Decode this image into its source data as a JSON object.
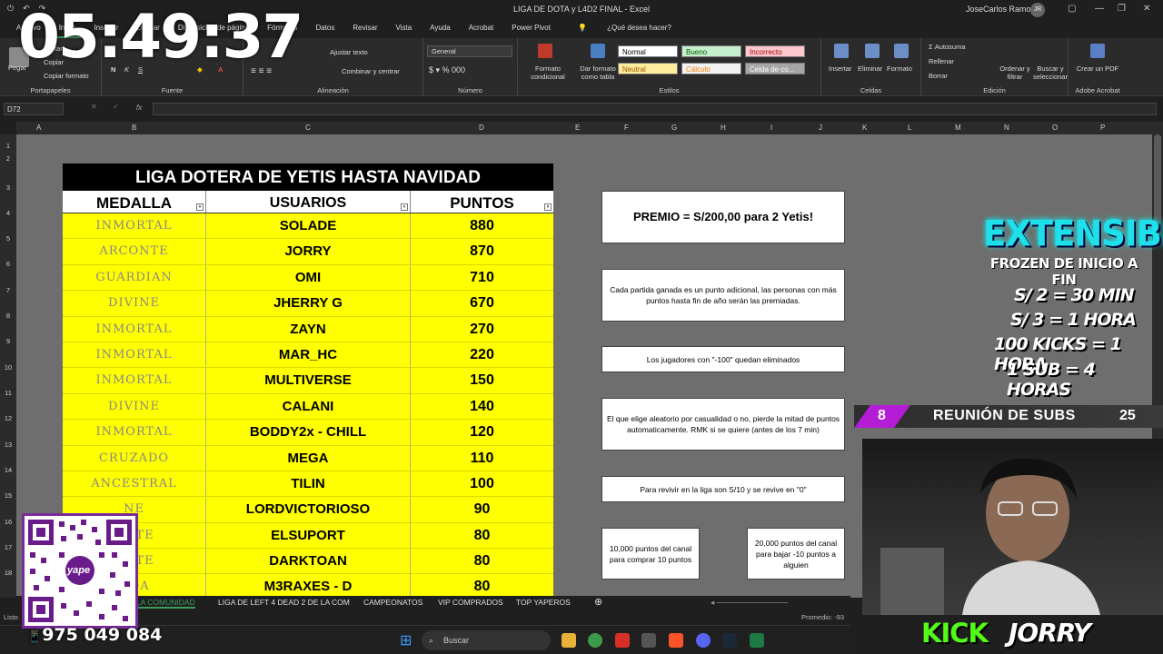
{
  "window": {
    "title": "LIGA DE DOTA y L4D2 FINAL  -  Excel",
    "user": "JoseCarlos Ramos",
    "user_initials": "JR"
  },
  "ribbon_tabs": [
    "Archivo",
    "Inicio",
    "Insertar",
    "Dibujar",
    "Disposición de página",
    "Fórmulas",
    "Datos",
    "Revisar",
    "Vista",
    "Ayuda",
    "Acrobat",
    "Power Pivot"
  ],
  "tell_me": "¿Qué desea hacer?",
  "ribbon": {
    "clipboard": {
      "paste": "Pegar",
      "cut": "Cortar",
      "copy": "Copiar",
      "format_painter": "Copiar formato",
      "label": "Portapapeles"
    },
    "font": {
      "label": "Fuente"
    },
    "alignment": {
      "wrap": "Ajustar texto",
      "merge": "Combinar y centrar",
      "label": "Alineación"
    },
    "number": {
      "format": "General",
      "label": "Número"
    },
    "styles": {
      "conditional": "Formato condicional",
      "as_table": "Dar formato como tabla",
      "normal": "Normal",
      "good": "Bueno",
      "bad": "Incorrecto",
      "neutral": "Neutral",
      "calc": "Cálculo",
      "cell": "Celda de co...",
      "label": "Estilos"
    },
    "cells": {
      "insert": "Insertar",
      "delete": "Eliminar",
      "format": "Formato",
      "label": "Celdas"
    },
    "editing": {
      "autosum": "Autosuma",
      "fill": "Rellenar",
      "clear": "Borrar",
      "sort": "Ordenar y filtrar",
      "find": "Buscar y seleccionar",
      "label": "Edición"
    },
    "acrobat": {
      "create_pdf": "Crear un PDF",
      "label": "Adobe Acrobat"
    }
  },
  "name_box": "D72",
  "columns": [
    "A",
    "B",
    "C",
    "D",
    "E",
    "F",
    "G",
    "H",
    "I",
    "J",
    "K",
    "L",
    "M",
    "N",
    "O",
    "P"
  ],
  "rows": [
    "1",
    "2",
    "3",
    "4",
    "5",
    "6",
    "7",
    "8",
    "9",
    "10",
    "11",
    "12",
    "13",
    "14",
    "15",
    "16",
    "17",
    "18"
  ],
  "league": {
    "title": "LIGA DOTERA DE YETIS HASTA NAVIDAD",
    "headers": [
      "MEDALLA",
      "USUARIOS",
      "PUNTOS"
    ],
    "rows": [
      {
        "medal": "INMORTAL",
        "user": "SOLADE",
        "points": "880"
      },
      {
        "medal": "ARCONTE",
        "user": "JORRY",
        "points": "870"
      },
      {
        "medal": "GUARDIAN",
        "user": "OMI",
        "points": "710"
      },
      {
        "medal": "DIVINE",
        "user": "JHERRY G",
        "points": "670"
      },
      {
        "medal": "INMORTAL",
        "user": "ZAYN",
        "points": "270"
      },
      {
        "medal": "INMORTAL",
        "user": "MAR_HC",
        "points": "220"
      },
      {
        "medal": "INMORTAL",
        "user": "MULTIVERSE",
        "points": "150"
      },
      {
        "medal": "DIVINE",
        "user": "CALANI",
        "points": "140"
      },
      {
        "medal": "INMORTAL",
        "user": "BODDY2x - CHILL",
        "points": "120"
      },
      {
        "medal": "CRUZADO",
        "user": "MEGA",
        "points": "110"
      },
      {
        "medal": "ANCESTRAL",
        "user": "TILIN",
        "points": "100"
      },
      {
        "medal": "NE",
        "user": "LORDVICTORIOSO",
        "points": "90"
      },
      {
        "medal": "ONTE",
        "user": "ELSUPORT",
        "points": "80"
      },
      {
        "medal": "ONTE",
        "user": "DARKTOAN",
        "points": "80"
      },
      {
        "medal": "NDA",
        "user": "M3RAXES - D",
        "points": "80"
      }
    ]
  },
  "notes": {
    "prize": "PREMIO = S/200,00  para 2 Yetis!",
    "rule1": "Cada partida ganada es un punto adicional, las personas con más puntos hasta fin de año serán  las premiadas.",
    "rule2": "Los jugadores con \"-100\" quedan eliminados",
    "rule3": "El que elige aleatorio por casualidad o no, pierde la mitad de puntos automaticamente. RMK si se quiere  (antes de los 7 min)",
    "rule4": "Para revivir en la liga son S/10 y se revive en \"0\"",
    "rule5": "10,000 puntos del canal para comprar 10 puntos",
    "rule6": "20,000 puntos del canal para bajar -10 puntos a alguien"
  },
  "sheet_tabs": [
    "LA COMUNIDAD",
    "LIGA DE LEFT 4 DEAD 2 DE LA COM",
    "CAMPEONATOS",
    "VIP COMPRADOS",
    "TOP YAPEROS"
  ],
  "status": {
    "left": "Listo",
    "right": "Promedio: -93"
  },
  "taskbar": {
    "search": "Buscar"
  },
  "stream": {
    "clock": "05:49:37",
    "yape_number": "975 049 084",
    "yape_brand": "yape",
    "extensible": "EXTENSIBLE",
    "frozen": "FROZEN DE INICIO A FIN",
    "prices": [
      "S/ 2 = 30 MIN",
      "S/ 3  = 1 HORA",
      "100 KICKS = 1 HORA",
      "1 SUB = 4 HORAS"
    ],
    "subs_left": "8",
    "subs_label": "REUNIÓN DE SUBS",
    "subs_right": "25",
    "kick": "KICK",
    "channel": "JORRY"
  },
  "colors": {
    "yellow": "#ffff00",
    "kick_green": "#53fc18",
    "cyan": "#1ee0ea",
    "purple": "#b51cd6",
    "excel_green": "#3a9d5d"
  }
}
